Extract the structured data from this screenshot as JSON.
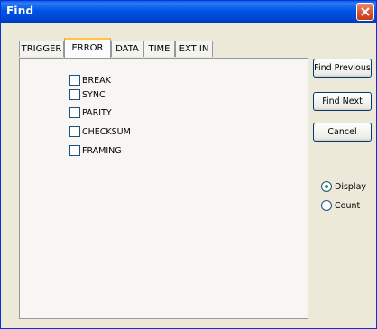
{
  "window": {
    "title": "Find"
  },
  "tabs": [
    {
      "label": "TRIGGER",
      "active": false
    },
    {
      "label": "ERROR",
      "active": true
    },
    {
      "label": "DATA",
      "active": false
    },
    {
      "label": "TIME",
      "active": false
    },
    {
      "label": "EXT IN",
      "active": false
    }
  ],
  "error_options": [
    {
      "label": "BREAK",
      "checked": false
    },
    {
      "label": "SYNC",
      "checked": false
    },
    {
      "label": "PARITY",
      "checked": false
    },
    {
      "label": "CHECKSUM",
      "checked": false
    },
    {
      "label": "FRAMING",
      "checked": false
    }
  ],
  "buttons": {
    "find_previous": "Find Previous",
    "find_next": "Find Next",
    "cancel": "Cancel"
  },
  "mode": {
    "options": [
      {
        "label": "Display",
        "selected": true
      },
      {
        "label": "Count",
        "selected": false
      }
    ]
  },
  "colors": {
    "titlebar": "#0055e5",
    "active_tab_accent": "#ffc83c",
    "radio_dot": "#21a121"
  }
}
